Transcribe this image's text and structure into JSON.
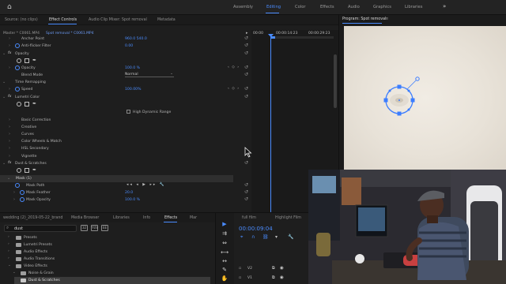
{
  "workspace": {
    "tabs": [
      "Assembly",
      "Editing",
      "Color",
      "Effects",
      "Audio",
      "Graphics",
      "Libraries"
    ],
    "active": "Editing",
    "more": "»"
  },
  "effect_controls": {
    "tabs": [
      "Source: (no clips)",
      "Effect Controls",
      "Audio Clip Mixer: Spot removal",
      "Metadata"
    ],
    "master_label": "Master * C0061.MP4",
    "clip_label": "Spot removal * C0061.MP4",
    "timecodes": [
      "00:00",
      "00:00:14:23",
      "00:00:29:23"
    ],
    "current_timecode": "00:00:09:04",
    "rows": {
      "anchor_point": {
        "label": "Anchor Point",
        "value": "960.0   540.0"
      },
      "anti_flicker": {
        "label": "Anti-flicker Filter",
        "value": "0.00"
      },
      "opacity_group": {
        "label": "Opacity"
      },
      "opacity": {
        "label": "Opacity",
        "value": "100.0 %"
      },
      "blend_mode": {
        "label": "Blend Mode",
        "value": "Normal"
      },
      "time_remap": {
        "label": "Time Remapping"
      },
      "speed": {
        "label": "Speed",
        "value": "100.00%"
      },
      "lumetri": {
        "label": "Lumetri Color"
      },
      "hdr": {
        "label": "High Dynamic Range"
      },
      "basic": {
        "label": "Basic Correction"
      },
      "creative": {
        "label": "Creative"
      },
      "curves": {
        "label": "Curves"
      },
      "wheels": {
        "label": "Color Wheels & Match"
      },
      "hsl": {
        "label": "HSL Secondary"
      },
      "vignette": {
        "label": "Vignette"
      },
      "dust": {
        "label": "Dust & Scratches"
      },
      "mask": {
        "label": "Mask (1)"
      },
      "mask_path": {
        "label": "Mask Path"
      },
      "mask_feather": {
        "label": "Mask Feather",
        "value": "20.0"
      },
      "mask_opacity": {
        "label": "Mask Opacity",
        "value": "100.0 %"
      }
    },
    "fx": "fx",
    "reset": "↺",
    "kf_nav": "‹ ◇ ›",
    "mask_path_ctrls": "◂◂ ◂ ▶ ▸▸ 🔧"
  },
  "program": {
    "title": "Program: Spot removal",
    "menu": "≡"
  },
  "project": {
    "tabs": [
      "wedding (2)_2019-05-22_brand",
      "Media Browser",
      "Libraries",
      "Info",
      "Effects",
      "Mar"
    ],
    "active_tab": "Effects",
    "search_value": "dust",
    "folders": [
      {
        "label": "Presets",
        "selected": false
      },
      {
        "label": "Lumetri Presets",
        "selected": false
      },
      {
        "label": "Audio Effects",
        "selected": false
      },
      {
        "label": "Audio Transitions",
        "selected": false
      },
      {
        "label": "Video Effects",
        "selected": false
      },
      {
        "label": "Noise & Grain",
        "selected": false
      },
      {
        "label": "Dust & Scratches",
        "selected": true
      }
    ],
    "icons": [
      "32",
      "YUV",
      "EE"
    ]
  },
  "tools": [
    "▶",
    "⇉",
    "⇔",
    "⟷",
    "↔",
    "✎",
    "✋",
    "T"
  ],
  "timeline": {
    "tabs": [
      "full film",
      "Highlight Film"
    ],
    "timecode": "00:00:09:04",
    "tracks": [
      {
        "label": "V2",
        "id": "v2"
      },
      {
        "label": "V1",
        "id": "v1"
      }
    ]
  },
  "colors": {
    "accent": "#4a8cff",
    "panel": "#1e1e1e"
  }
}
